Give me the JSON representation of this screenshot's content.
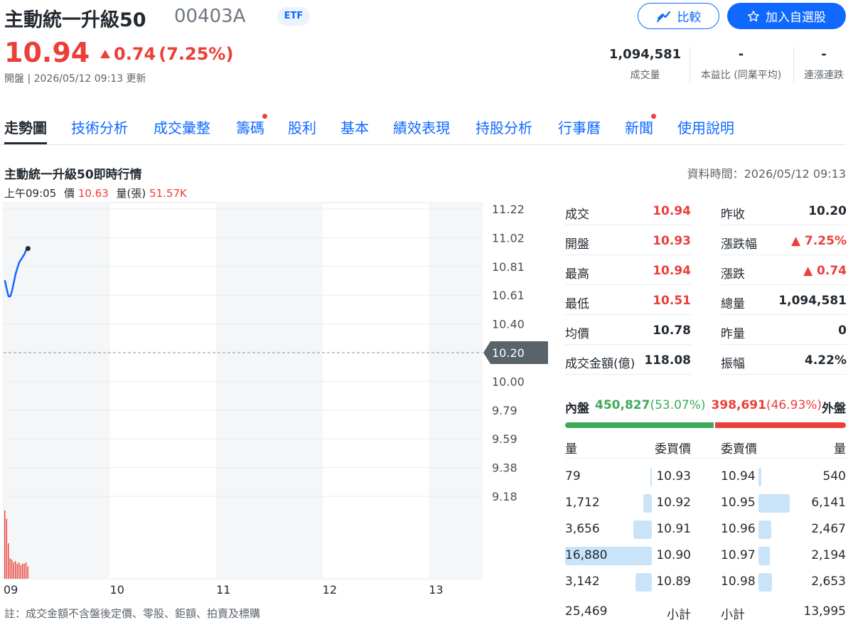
{
  "header": {
    "name": "主動統一升級50",
    "symbol": "00403A",
    "badge": "ETF",
    "compare_label": "比較",
    "watch_label": "加入自選股",
    "price": "10.94",
    "change": "0.74",
    "change_pct": "(7.25%)",
    "status": "開盤 | 2026/05/12 09:13 更新"
  },
  "stats": [
    {
      "value": "1,094,581",
      "label": "成交量"
    },
    {
      "value": "-",
      "label": "本益比 (同業平均)"
    },
    {
      "value": "-",
      "label": "連漲連跌"
    }
  ],
  "tabs": [
    {
      "label": "走勢圖",
      "active": true,
      "dot": false
    },
    {
      "label": "技術分析",
      "active": false,
      "dot": false
    },
    {
      "label": "成交彙整",
      "active": false,
      "dot": false
    },
    {
      "label": "籌碼",
      "active": false,
      "dot": true
    },
    {
      "label": "股利",
      "active": false,
      "dot": false
    },
    {
      "label": "基本",
      "active": false,
      "dot": false
    },
    {
      "label": "績效表現",
      "active": false,
      "dot": false
    },
    {
      "label": "持股分析",
      "active": false,
      "dot": false
    },
    {
      "label": "行事曆",
      "active": false,
      "dot": false
    },
    {
      "label": "新聞",
      "active": false,
      "dot": true
    },
    {
      "label": "使用說明",
      "active": false,
      "dot": false
    }
  ],
  "chart_section": {
    "title": "主動統一升級50即時行情",
    "data_time": "資料時間：2026/05/12 09:13",
    "tooltip": {
      "time": "上午09:05",
      "price_label": "價",
      "price": "10.63",
      "vol_label": "量(張)",
      "vol": "51.57K"
    },
    "footnote": "註：成交金額不含盤後定價、零股、鉅額、拍賣及標購"
  },
  "chart_data": {
    "type": "line",
    "y_ticks": [
      "11.22",
      "11.02",
      "10.81",
      "10.61",
      "10.40",
      "10.20",
      "10.00",
      "9.79",
      "9.59",
      "9.38",
      "9.18"
    ],
    "reference_price": "10.20",
    "x_ticks": [
      "09",
      "10",
      "11",
      "12",
      "13"
    ],
    "ylim": [
      9.18,
      11.22
    ],
    "x_minutes": [
      0,
      0.5,
      1,
      1.5,
      2,
      2.5,
      3,
      3.5,
      4,
      4.5,
      5,
      5.5,
      6,
      6.5,
      7,
      7.5,
      8,
      8.5,
      9,
      9.5,
      10,
      10.5,
      11,
      11.5,
      12,
      12.5,
      13
    ],
    "prices": [
      10.71,
      10.65,
      10.6,
      10.6,
      10.64,
      10.7,
      10.76,
      10.8,
      10.84,
      10.86,
      10.88,
      10.9,
      10.93,
      10.94
    ],
    "price_minutes": [
      0,
      1,
      2,
      3,
      4,
      5,
      6,
      7,
      8,
      9,
      10,
      11,
      12,
      13
    ],
    "volume_minutes": [
      0,
      1,
      2,
      3,
      4,
      5,
      6,
      7,
      8,
      9,
      10,
      11,
      12,
      13
    ],
    "volumes": [
      100,
      88,
      52,
      30,
      28,
      24,
      26,
      22,
      24,
      20,
      22,
      22,
      24,
      18
    ],
    "volume_max": 100,
    "line_color": "#0f69ff",
    "volume_color": "#eb3f38"
  },
  "quote_left": [
    {
      "label": "成交",
      "value": "10.94",
      "color": "red"
    },
    {
      "label": "開盤",
      "value": "10.93",
      "color": "red"
    },
    {
      "label": "最高",
      "value": "10.94",
      "color": "red"
    },
    {
      "label": "最低",
      "value": "10.51",
      "color": "red"
    },
    {
      "label": "均價",
      "value": "10.78",
      "color": "black"
    },
    {
      "label": "成交金額(億)",
      "value": "118.08",
      "color": "black"
    }
  ],
  "quote_right": [
    {
      "label": "昨收",
      "value": "10.20",
      "color": "black"
    },
    {
      "label": "漲跌幅",
      "value": "▲ 7.25%",
      "color": "red"
    },
    {
      "label": "漲跌",
      "value": "▲ 0.74",
      "color": "red"
    },
    {
      "label": "總量",
      "value": "1,094,581",
      "color": "black"
    },
    {
      "label": "昨量",
      "value": "0",
      "color": "black"
    },
    {
      "label": "振幅",
      "value": "4.22%",
      "color": "black"
    }
  ],
  "inout": {
    "in_label": "內盤",
    "in_value": "450,827",
    "in_pct": "(53.07%)",
    "out_value": "398,691",
    "out_pct": "(46.93%)",
    "out_label": "外盤",
    "in_ratio": 0.5307
  },
  "orderbook": {
    "headers": {
      "bid_vol": "量",
      "bid_price": "委買價",
      "ask_price": "委賣價",
      "ask_vol": "量"
    },
    "rows": [
      {
        "bid_vol": "79",
        "bid_price": "10.93",
        "ask_price": "10.94",
        "ask_vol": "540",
        "bid_ratio": 0.005,
        "ask_ratio": 0.032
      },
      {
        "bid_vol": "1,712",
        "bid_price": "10.92",
        "ask_price": "10.95",
        "ask_vol": "6,141",
        "bid_ratio": 0.101,
        "ask_ratio": 0.364
      },
      {
        "bid_vol": "3,656",
        "bid_price": "10.91",
        "ask_price": "10.96",
        "ask_vol": "2,467",
        "bid_ratio": 0.217,
        "ask_ratio": 0.146
      },
      {
        "bid_vol": "16,880",
        "bid_price": "10.90",
        "ask_price": "10.97",
        "ask_vol": "2,194",
        "bid_ratio": 1.0,
        "ask_ratio": 0.13
      },
      {
        "bid_vol": "3,142",
        "bid_price": "10.89",
        "ask_price": "10.98",
        "ask_vol": "2,653",
        "bid_ratio": 0.186,
        "ask_ratio": 0.157
      }
    ],
    "subtotal_label": "小計",
    "bid_subtotal": "25,469",
    "ask_subtotal": "13,995"
  }
}
